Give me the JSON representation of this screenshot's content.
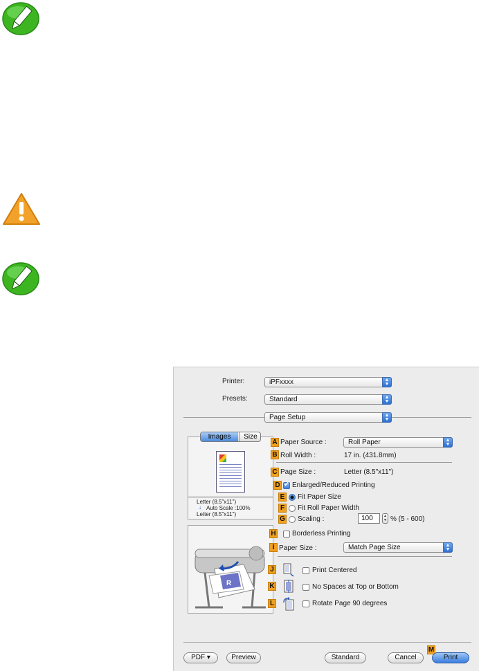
{
  "dialog": {
    "printer": {
      "label": "Printer:",
      "value": "iPFxxxx"
    },
    "presets": {
      "label": "Presets:",
      "value": "Standard"
    },
    "section": {
      "value": "Page Setup"
    },
    "tabs": [
      {
        "label": "Images"
      },
      {
        "label": "Size"
      }
    ],
    "preview_info": {
      "line1": "Letter (8.5\"x11\")",
      "line2": "Auto Scale :100%",
      "line3": "Letter (8.5\"x11\")"
    },
    "badges": {
      "A": "A",
      "B": "B",
      "C": "C",
      "D": "D",
      "E": "E",
      "F": "F",
      "G": "G",
      "H": "H",
      "I": "I",
      "J": "J",
      "K": "K",
      "L": "L",
      "M": "M"
    },
    "paper_source": {
      "label": "Paper Source :",
      "value": "Roll Paper"
    },
    "roll_width": {
      "label": "Roll Width :",
      "value": "17 in. (431.8mm)"
    },
    "page_size": {
      "label": "Page Size :",
      "value": "Letter (8.5\"x11\")"
    },
    "enlarged": {
      "label": "Enlarged/Reduced Printing",
      "checked": true
    },
    "fit_paper_size": {
      "label": "Fit Paper Size",
      "selected": true
    },
    "fit_roll_width": {
      "label": "Fit Roll Paper Width",
      "selected": false
    },
    "scaling": {
      "label": "Scaling :",
      "value": "100",
      "range": "% (5 - 600)"
    },
    "borderless": {
      "label": "Borderless Printing",
      "checked": false
    },
    "paper_size": {
      "label": "Paper Size :",
      "value": "Match Page Size"
    },
    "print_centered": {
      "label": "Print Centered",
      "checked": false
    },
    "no_spaces": {
      "label": "No Spaces at Top or Bottom",
      "checked": false
    },
    "rotate": {
      "label": "Rotate Page 90 degrees",
      "checked": false
    },
    "buttons": {
      "pdf": "PDF ▾",
      "preview": "Preview",
      "standard": "Standard",
      "cancel": "Cancel",
      "print": "Print"
    }
  },
  "colors": {
    "note_green": "#3cb521",
    "caution_orange": "#f2a22b",
    "badge": "#f0a020",
    "accent_blue": "#3a7de0"
  }
}
